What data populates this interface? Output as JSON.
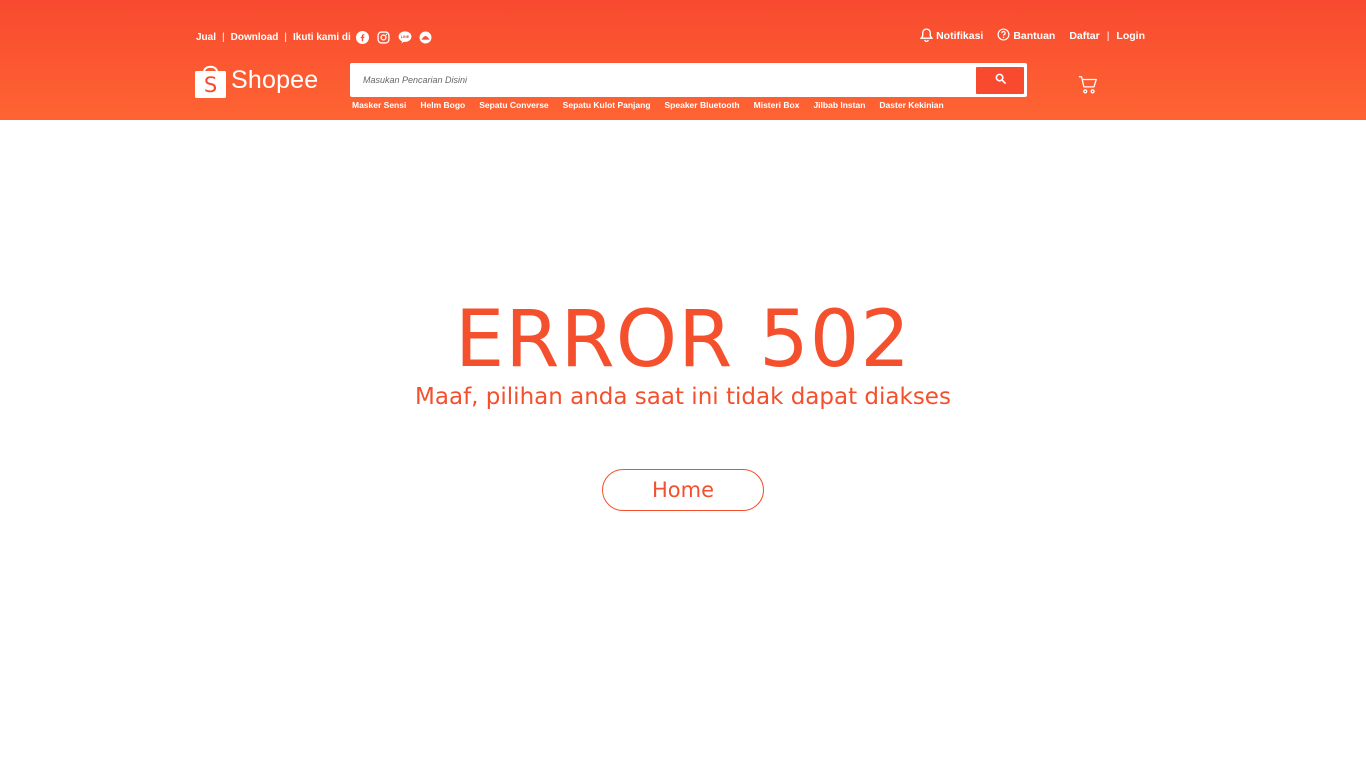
{
  "topbar": {
    "jual": "Jual",
    "sep": "|",
    "download": "Download",
    "ikuti": "Ikuti kami di",
    "social_icons": [
      "facebook-icon",
      "instagram-icon",
      "line-icon",
      "shopee-food-icon"
    ]
  },
  "topright": {
    "notifikasi": "Notifikasi",
    "bantuan": "Bantuan",
    "daftar": "Daftar",
    "sep": "|",
    "login": "Login"
  },
  "logo": {
    "word": "Shopee",
    "letter": "S"
  },
  "search": {
    "placeholder": "Masukan Pencarian Disini",
    "value": ""
  },
  "suggestions": [
    "Masker Sensi",
    "Helm Bogo",
    "Sepatu Converse",
    "Sepatu Kulot Panjang",
    "Speaker Bluetooth",
    "Misteri Box",
    "Jilbab Instan",
    "Daster Kekinian"
  ],
  "error": {
    "title": "ERROR 502",
    "subtitle": "Maaf, pilihan anda saat ini tidak dapat diakses",
    "home_label": "Home"
  },
  "colors": {
    "header_top": "#f84a2f",
    "header_bottom": "#fe6433",
    "accent": "#f4502d",
    "background": "#ffffff"
  }
}
